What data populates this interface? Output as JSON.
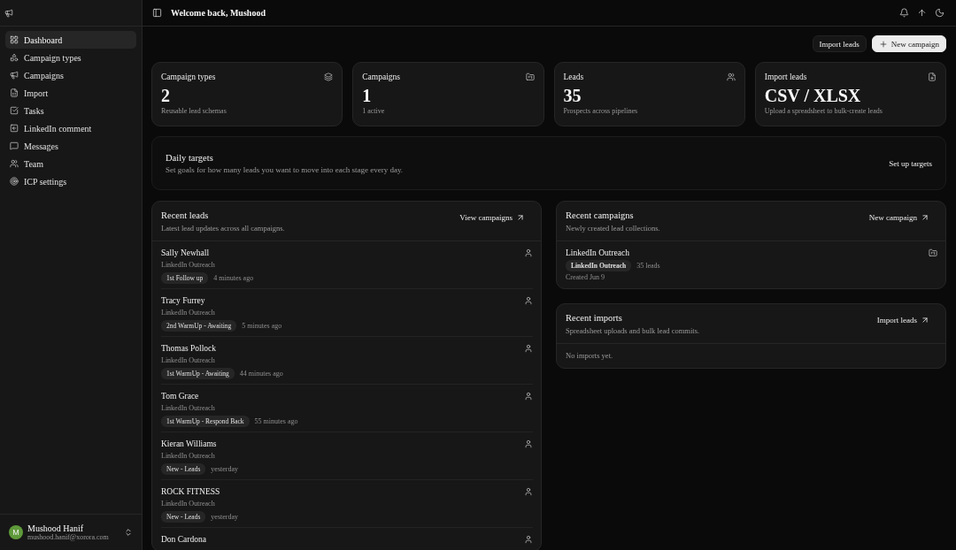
{
  "sidebar": {
    "items": [
      {
        "label": "Dashboard",
        "selected": true
      },
      {
        "label": "Campaign types",
        "selected": false
      },
      {
        "label": "Campaigns",
        "selected": false
      },
      {
        "label": "Import",
        "selected": false
      },
      {
        "label": "Tasks",
        "selected": false
      },
      {
        "label": "LinkedIn comment",
        "selected": false
      },
      {
        "label": "Messages",
        "selected": false
      },
      {
        "label": "Team",
        "selected": false
      },
      {
        "label": "ICP settings",
        "selected": false
      }
    ],
    "user": {
      "initial": "M",
      "name": "Mushood Hanif",
      "email": "mushood.hanif@xorora.com"
    }
  },
  "header": {
    "title": "Welcome back, Mushood"
  },
  "actions": [
    {
      "label": "Import leads",
      "kind": "outline"
    },
    {
      "label": "New campaign",
      "kind": "primary"
    }
  ],
  "stats": [
    {
      "title": "Campaign types",
      "value": "2",
      "caption": "Reusable lead schemas"
    },
    {
      "title": "Campaigns",
      "value": "1",
      "caption": "1 active"
    },
    {
      "title": "Leads",
      "value": "35",
      "caption": "Prospects across pipelines"
    },
    {
      "title": "Import leads",
      "value": "CSV / XLSX",
      "caption": "Upload a spreadsheet to bulk-create leads"
    }
  ],
  "daily_targets": {
    "title": "Daily targets",
    "description": "Set goals for how many leads you want to move into each stage every day.",
    "action": "Set up targets"
  },
  "recent_leads": {
    "title": "Recent leads",
    "subtitle": "Latest lead updates across all campaigns.",
    "action": "View campaigns",
    "rows": [
      {
        "name": "Sally Newhall",
        "campaign": "LinkedIn Outreach",
        "stage": "1st Follow up",
        "time": "4 minutes ago"
      },
      {
        "name": "Tracy Furrey",
        "campaign": "LinkedIn Outreach",
        "stage": "2nd WarmUp - Awaiting",
        "time": "5 minutes ago"
      },
      {
        "name": "Thomas Pollock",
        "campaign": "LinkedIn Outreach",
        "stage": "1st WarmUp - Awaiting",
        "time": "44 minutes ago"
      },
      {
        "name": "Tom Grace",
        "campaign": "LinkedIn Outreach",
        "stage": "1st WarmUp - Respond Back",
        "time": "55 minutes ago"
      },
      {
        "name": "Kieran Williams",
        "campaign": "LinkedIn Outreach",
        "stage": "New - Leads",
        "time": "yesterday"
      },
      {
        "name": "ROCK FITNESS",
        "campaign": "LinkedIn Outreach",
        "stage": "New - Leads",
        "time": "yesterday"
      },
      {
        "name": "Don Cardona"
      }
    ]
  },
  "recent_campaigns": {
    "title": "Recent campaigns",
    "subtitle": "Newly created lead collections.",
    "action": "New campaign",
    "rows": [
      {
        "name": "LinkedIn Outreach",
        "tag": "LinkedIn Outreach",
        "count": "35 leads",
        "created": "Created Jun 9"
      }
    ]
  },
  "recent_imports": {
    "title": "Recent imports",
    "subtitle": "Spreadsheet uploads and bulk lead commits.",
    "action": "Import leads",
    "empty": "No imports yet."
  }
}
